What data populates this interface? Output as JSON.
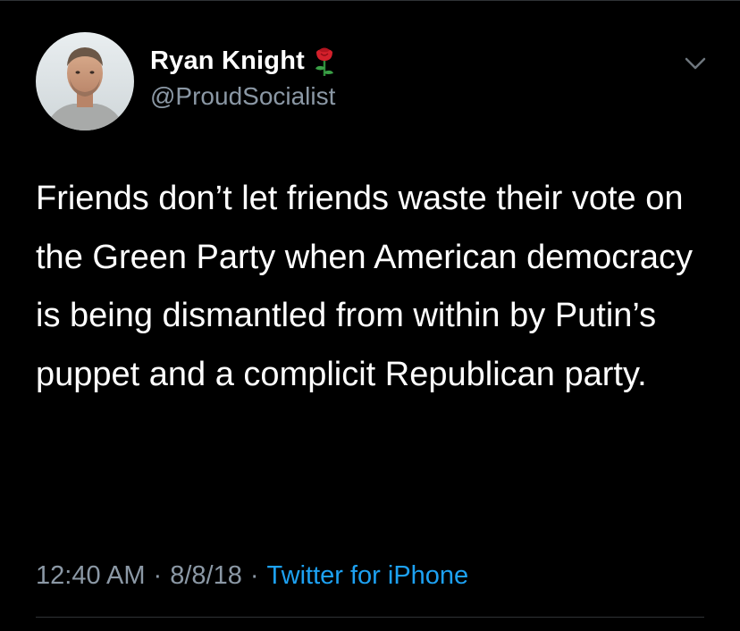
{
  "tweet": {
    "author": {
      "display_name": "Ryan Knight",
      "handle": "@ProudSocialist",
      "name_emoji": "rose-icon"
    },
    "text": "Friends don’t let friends waste their vote on the Green Party when American democracy is being dismantled from within by Putin’s puppet and a complicit Republican party.",
    "time": "12:40 AM",
    "date": "8/8/18",
    "source": "Twitter for iPhone",
    "separator": "·"
  },
  "colors": {
    "background": "#000000",
    "text_primary": "#ffffff",
    "text_secondary": "#8b98a5",
    "link": "#1da1f2",
    "divider": "#2f3336"
  },
  "icons": {
    "menu": "chevron-down-icon",
    "avatar": "avatar"
  }
}
